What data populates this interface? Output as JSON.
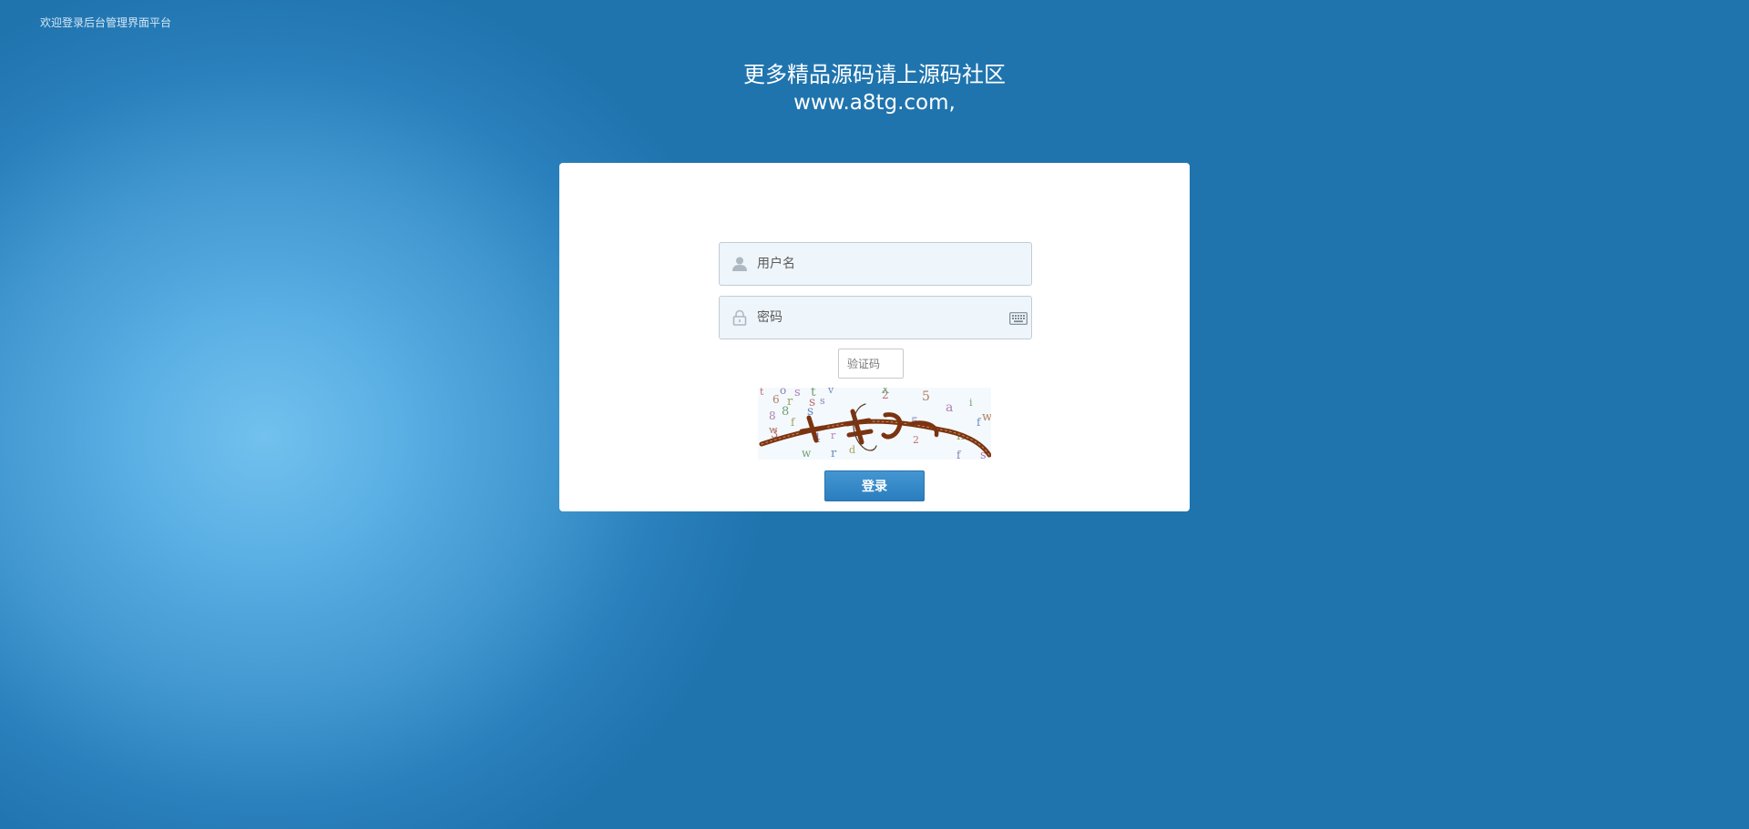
{
  "header": {
    "welcome_text": "欢迎登录后台管理界面平台"
  },
  "headline": {
    "line1": "更多精品源码请上源码社区",
    "line2": "www.a8tg.com,"
  },
  "form": {
    "username_placeholder": "用户名",
    "password_placeholder": "密码",
    "captcha_placeholder": "验证码",
    "login_label": "登录"
  },
  "captcha": {
    "noise_chars": [
      "t",
      "o",
      "s",
      "t",
      "v",
      "6",
      "r",
      "s",
      "s",
      "8",
      "8",
      "s",
      "w",
      "f",
      "3",
      "4",
      "r",
      "w",
      "r",
      "5",
      "d",
      "2",
      "5",
      "a",
      "i",
      "f",
      "w",
      "n",
      "2",
      "f",
      "s",
      "x"
    ]
  },
  "colors": {
    "background": "#1f74ae",
    "panel": "#ffffff",
    "button": "#2a7ebe",
    "field_bg": "#eef5fb"
  },
  "icons": {
    "username": "user-icon",
    "password": "lock-icon",
    "keyboard": "keyboard-icon"
  }
}
